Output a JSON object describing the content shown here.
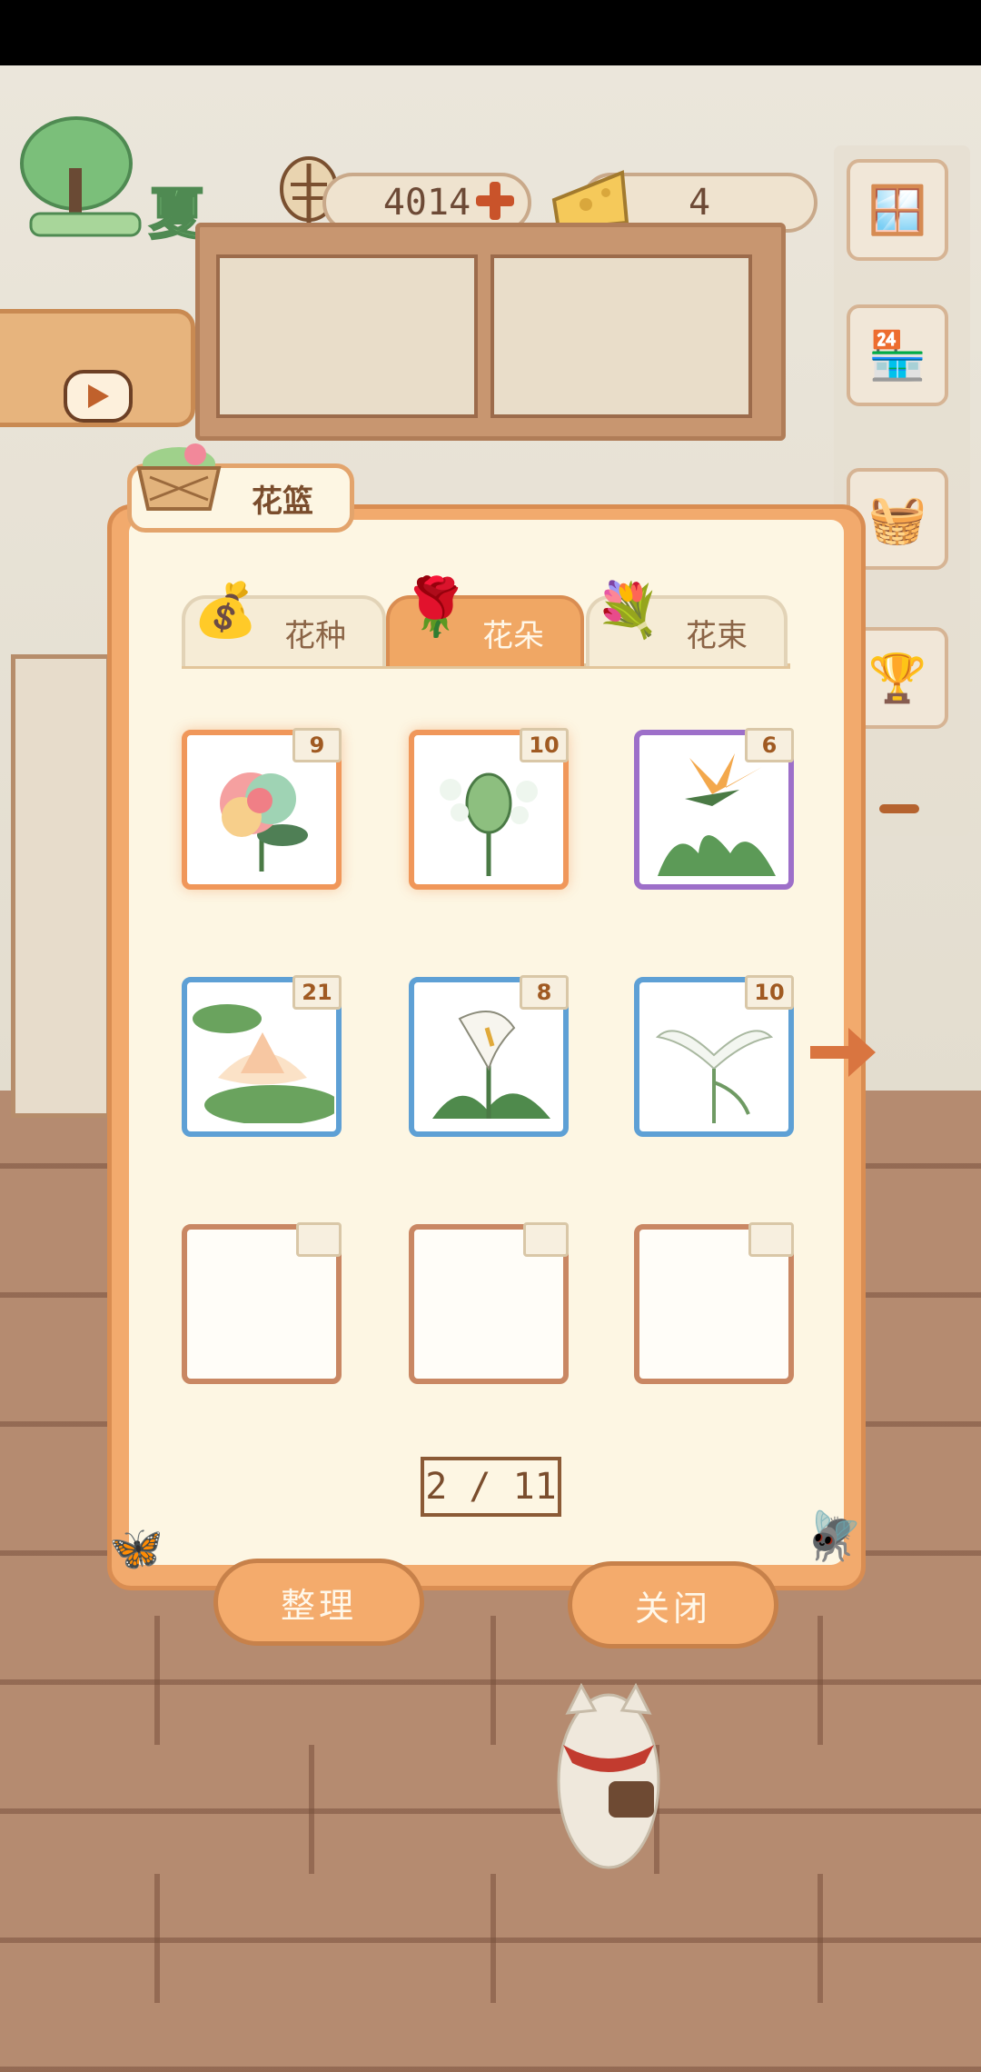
{
  "hud": {
    "season": "夏",
    "fish_count": "4014",
    "cheese_count": "4"
  },
  "dialog": {
    "title": "花篮",
    "tabs": [
      {
        "label": "花种",
        "active": false
      },
      {
        "label": "花朵",
        "active": true
      },
      {
        "label": "花束",
        "active": false
      }
    ],
    "items": [
      {
        "flower": "rainbow-peony",
        "count": "9",
        "rarity": "orange"
      },
      {
        "flower": "white-bud-flower",
        "count": "10",
        "rarity": "orange"
      },
      {
        "flower": "bird-of-paradise",
        "count": "6",
        "rarity": "purple"
      },
      {
        "flower": "water-lily",
        "count": "21",
        "rarity": "blue"
      },
      {
        "flower": "calla-lily",
        "count": "8",
        "rarity": "blue"
      },
      {
        "flower": "white-egret-orchid",
        "count": "10",
        "rarity": "blue"
      },
      {
        "flower": "",
        "count": "",
        "rarity": "empty"
      },
      {
        "flower": "",
        "count": "",
        "rarity": "empty"
      },
      {
        "flower": "",
        "count": "",
        "rarity": "empty"
      }
    ],
    "page": "2 / 11",
    "sort_label": "整理",
    "close_label": "关闭"
  },
  "colors": {
    "dialog_orange": "#f2aa6d",
    "panel_cream": "#fdf6e3",
    "rarity_orange": "#f0975a",
    "rarity_purple": "#9d6fc9",
    "rarity_blue": "#5ea0d5"
  }
}
